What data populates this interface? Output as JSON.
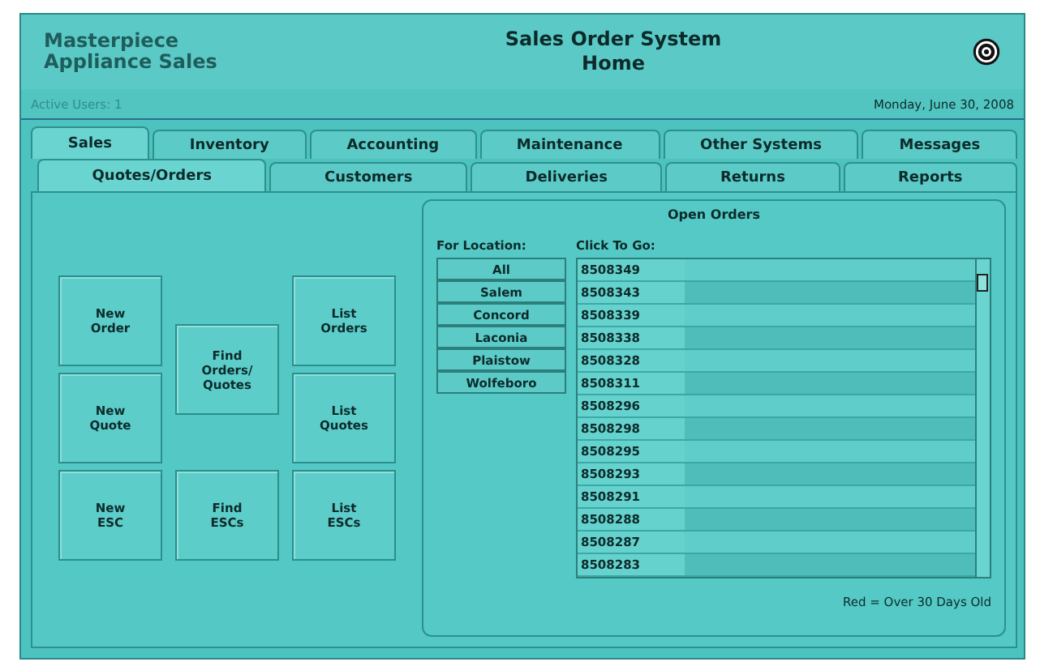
{
  "header": {
    "logo": "Masterpiece Appliance Sales",
    "title": "Sales Order System",
    "subtitle": "Home"
  },
  "status_bar": {
    "active_users": "Active Users: 1",
    "date": "Monday, June 30, 2008"
  },
  "tabs": [
    {
      "label": "Sales",
      "selected": true
    },
    {
      "label": "Inventory",
      "selected": false
    },
    {
      "label": "Accounting",
      "selected": false
    },
    {
      "label": "Maintenance",
      "selected": false
    },
    {
      "label": "Other Systems",
      "selected": false
    },
    {
      "label": "Messages",
      "selected": false
    }
  ],
  "subtabs": [
    {
      "label": "Quotes/Orders",
      "selected": true
    },
    {
      "label": "Customers",
      "selected": false
    },
    {
      "label": "Deliveries",
      "selected": false
    },
    {
      "label": "Returns",
      "selected": false
    },
    {
      "label": "Reports",
      "selected": false
    }
  ],
  "action_columns": [
    [
      "New\nOrder",
      "New\nQuote",
      "New\nESC"
    ],
    [
      "Find\nOrders/\nQuotes",
      "Find\nESCs"
    ],
    [
      "List\nOrders",
      "List\nQuotes",
      "List\nESCs"
    ]
  ],
  "open_orders": {
    "title": "Open Orders",
    "location_label": "For Location:",
    "locations": [
      "All",
      "Salem",
      "Concord",
      "Laconia",
      "Plaistow",
      "Wolfeboro"
    ],
    "orders_label": "Click To Go:",
    "orders": [
      "8508349",
      "8508343",
      "8508339",
      "8508338",
      "8508328",
      "8508311",
      "8508296",
      "8508298",
      "8508295",
      "8508293",
      "8508291",
      "8508288",
      "8508287",
      "8508283"
    ],
    "legend": "Red = Over 30 Days Old"
  }
}
